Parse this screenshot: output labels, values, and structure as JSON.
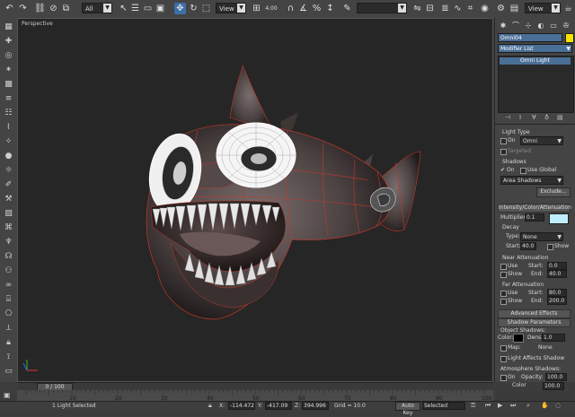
{
  "toolbar": {
    "selection_filter": "All",
    "ref_coord": "View",
    "snap_value": "4.00"
  },
  "right_toolbar": {
    "view_dropdown": "View"
  },
  "viewport": {
    "label": "Perspective"
  },
  "panel": {
    "object_name": "Omni04",
    "object_color": "#f5e300",
    "modifier_list": "Modifier List",
    "stack_item": "Omni Light",
    "light_type_header": "Light Type",
    "light_on_label": "On",
    "light_type_value": "Omni",
    "targeted_label": "Targeted",
    "shadows_label": "Shadows",
    "shadows_on_label": "On",
    "use_global_label": "Use Global",
    "shadow_type": "Area Shadows",
    "exclude_button": "Exclude...",
    "intensity_header": "Intensity/Color/Attenuation",
    "multiplier_label": "Multiplier:",
    "multiplier_value": "0.1",
    "light_color": "#bfefff",
    "decay_label": "Decay",
    "decay_type_label": "Type:",
    "decay_type_value": "None",
    "decay_start_label": "Start:",
    "decay_start_value": "40.0",
    "decay_show_label": "Show",
    "near_atten_label": "Near Attenuation",
    "near_use_label": "Use",
    "near_show_label": "Show",
    "near_start_label": "Start:",
    "near_start_value": "0.0",
    "near_end_label": "End:",
    "near_end_value": "40.0",
    "far_atten_label": "Far Attenuation",
    "far_use_label": "Use",
    "far_show_label": "Show",
    "far_start_label": "Start:",
    "far_start_value": "80.0",
    "far_end_label": "End:",
    "far_end_value": "200.0",
    "advanced_effects": "Advanced Effects",
    "shadow_params": "Shadow Parameters",
    "object_shadows_label": "Object Shadows:",
    "shadow_color_label": "Color:",
    "shadow_color": "#000000",
    "dens_label": "Dens.",
    "dens_value": "1.0",
    "map_label": "Map:",
    "map_value": "None",
    "light_affects_label": "Light Affects Shadow",
    "atmosphere_label": "Atmosphere Shadows:",
    "atm_on_label": "On",
    "opacity_label": "Opacity:",
    "opacity_value": "100.0",
    "atm_color_label": "Color",
    "atm_color_value": "100.0"
  },
  "timeline": {
    "frame": "0 / 100",
    "ticks": [
      "10",
      "20",
      "30",
      "40",
      "50",
      "60",
      "70",
      "80",
      "90",
      "100"
    ]
  },
  "status": {
    "selection": "1 Light Selected",
    "x_value": "-114.472",
    "y_value": "-417.09",
    "z_value": "394.996",
    "grid": "Grid = 10.0",
    "auto_key": "Auto Key",
    "selected": "Selected"
  }
}
